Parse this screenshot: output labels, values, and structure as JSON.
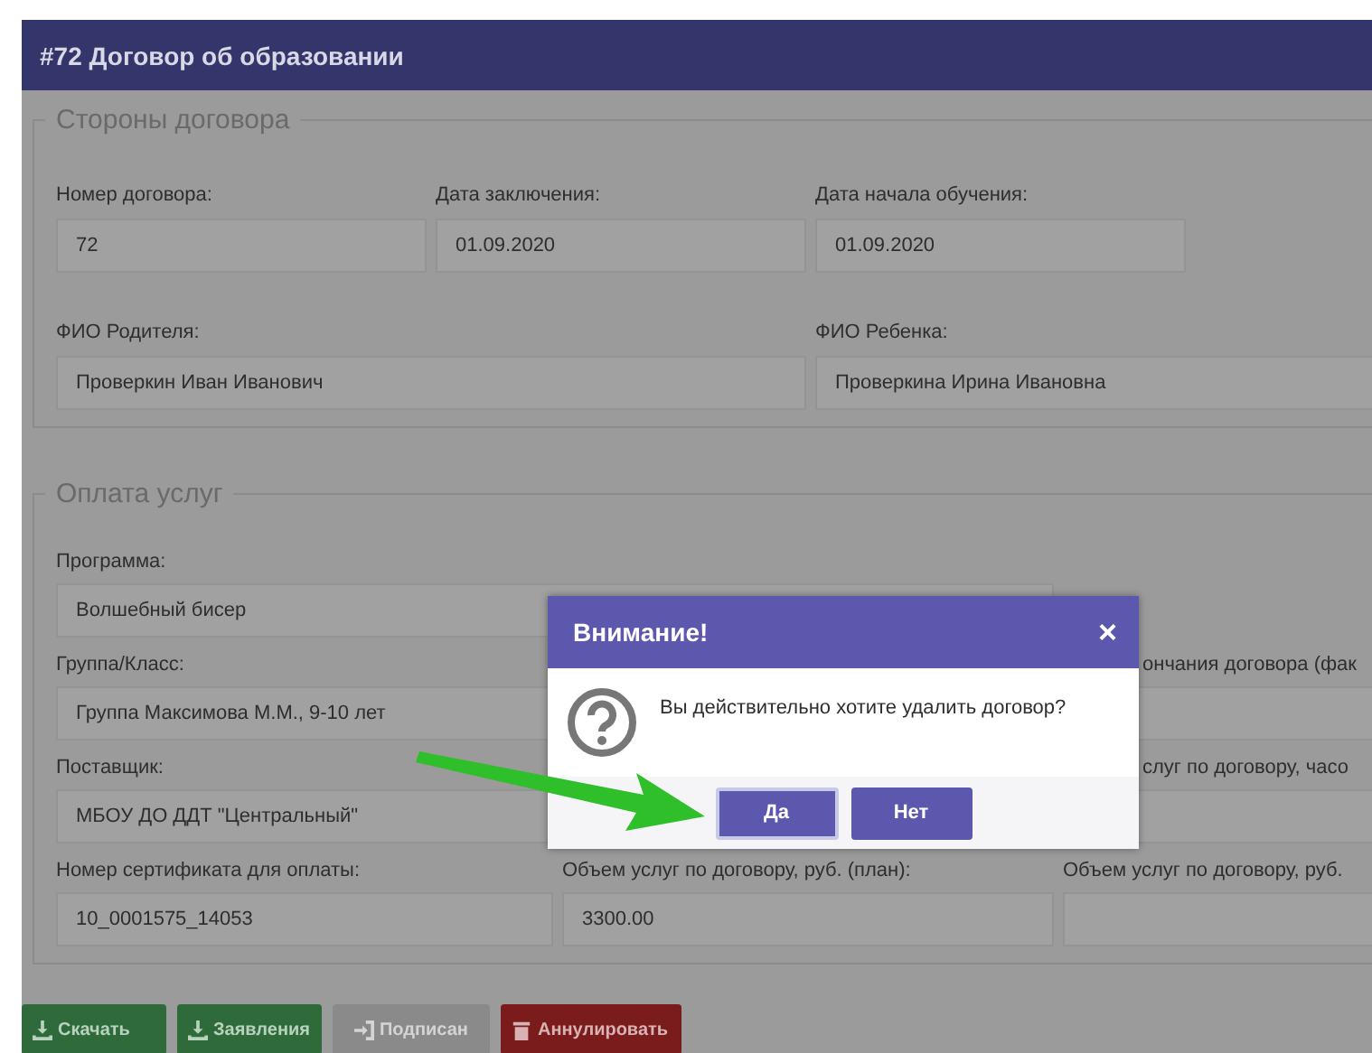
{
  "header": {
    "title": "#72 Договор об образовании"
  },
  "parties": {
    "legend": "Стороны договора",
    "fields": [
      {
        "label": "Номер договора:",
        "value": "72"
      },
      {
        "label": "Дата заключения:",
        "value": "01.09.2020"
      },
      {
        "label": "Дата начала обучения:",
        "value": "01.09.2020"
      },
      {
        "label": "ФИО Родителя:",
        "value": "Проверкин Иван Иванович"
      },
      {
        "label": "ФИО Ребенка:",
        "value": "Проверкина Ирина Ивановна"
      }
    ]
  },
  "payment": {
    "legend": "Оплата услуг",
    "fields": [
      {
        "label": "Программа:",
        "value": "Волшебный бисер"
      },
      {
        "label": "Группа/Класс:",
        "value": "Группа Максимова М.М., 9-10 лет"
      },
      {
        "label": "ончания договора (фак"
      },
      {
        "label": "Поставщик:",
        "value": "МБОУ ДО ДДТ \"Центральный\""
      },
      {
        "label": "слуг по договору, часо"
      },
      {
        "label": "Номер сертификата для оплаты:",
        "value": "10_0001575_14053"
      },
      {
        "label": "Объем услуг по договору, руб. (план):",
        "value": "3300.00"
      },
      {
        "label": "Объем услуг по договору, руб."
      }
    ]
  },
  "actions": [
    {
      "label": "Скачать",
      "kind": "download",
      "disabled": false
    },
    {
      "label": "Заявления",
      "kind": "download",
      "disabled": false
    },
    {
      "label": "Подписан",
      "kind": "signin",
      "disabled": true
    },
    {
      "label": "Аннулировать",
      "kind": "delete",
      "disabled": false
    }
  ],
  "dialog": {
    "title": "Внимание!",
    "close": "×",
    "message": "Вы действительно хотите удалить договор?",
    "buttons": [
      {
        "label": "Да",
        "focused": true
      },
      {
        "label": "Нет",
        "focused": false
      }
    ]
  }
}
